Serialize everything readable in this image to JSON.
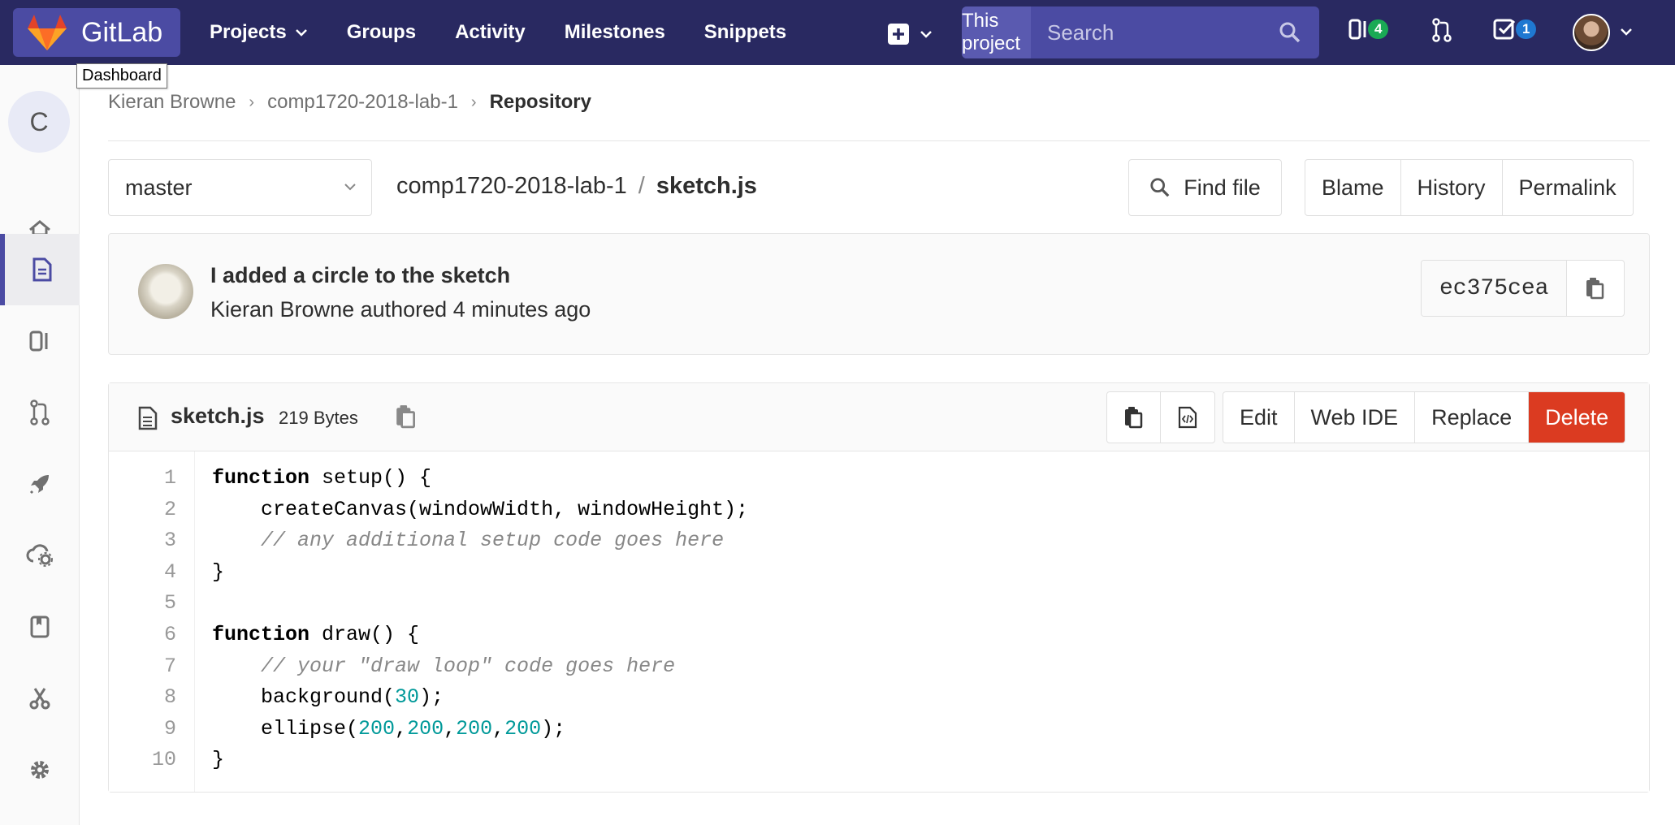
{
  "nav": {
    "brand": "GitLab",
    "links": [
      "Projects",
      "Groups",
      "Activity",
      "Milestones",
      "Snippets"
    ],
    "search_scope": "This project",
    "search_placeholder": "Search",
    "issues_count": "4",
    "todos_count": "1",
    "tooltip": "Dashboard"
  },
  "sidebar": {
    "project_letter": "C"
  },
  "breadcrumb": [
    "Kieran Browne",
    "comp1720-2018-lab-1",
    "Repository"
  ],
  "file_nav": {
    "branch": "master",
    "project": "comp1720-2018-lab-1",
    "file": "sketch.js",
    "find_file": "Find file",
    "actions": [
      "Blame",
      "History",
      "Permalink"
    ]
  },
  "commit": {
    "title": "I added a circle to the sketch",
    "meta": "Kieran Browne authored 4 minutes ago",
    "sha": "ec375cea"
  },
  "file": {
    "name": "sketch.js",
    "size": "219 Bytes",
    "actions": [
      "Edit",
      "Web IDE",
      "Replace",
      "Delete"
    ],
    "lines": [
      [
        {
          "t": "function",
          "c": "kw"
        },
        {
          "t": " setup() {"
        }
      ],
      [
        {
          "t": "    createCanvas(windowWidth, windowHeight);"
        }
      ],
      [
        {
          "t": "    // any additional setup code goes here",
          "c": "cm"
        }
      ],
      [
        {
          "t": "}"
        }
      ],
      [
        {
          "t": ""
        }
      ],
      [
        {
          "t": "function",
          "c": "kw"
        },
        {
          "t": " draw() {"
        }
      ],
      [
        {
          "t": "    // your \"draw loop\" code goes here",
          "c": "cm"
        }
      ],
      [
        {
          "t": "    background("
        },
        {
          "t": "30",
          "c": "num"
        },
        {
          "t": ");"
        }
      ],
      [
        {
          "t": "    ellipse("
        },
        {
          "t": "200",
          "c": "num"
        },
        {
          "t": ","
        },
        {
          "t": "200",
          "c": "num"
        },
        {
          "t": ","
        },
        {
          "t": "200",
          "c": "num"
        },
        {
          "t": ","
        },
        {
          "t": "200",
          "c": "num"
        },
        {
          "t": ");"
        }
      ],
      [
        {
          "t": "}"
        }
      ]
    ]
  }
}
